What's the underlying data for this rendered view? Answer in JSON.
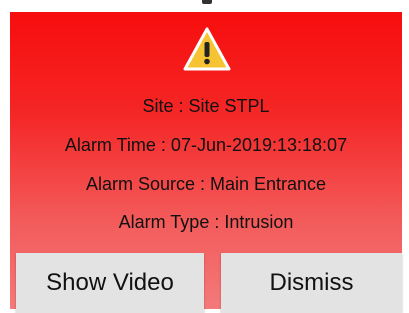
{
  "alarm": {
    "icon": "warning-icon",
    "site_line": "Site : Site STPL",
    "time_line": "Alarm Time : 07-Jun-2019:13:18:07",
    "source_line": "Alarm Source : Main Entrance",
    "type_line": "Alarm Type : Intrusion"
  },
  "actions": {
    "show_video_label": "Show Video",
    "dismiss_label": "Dismiss"
  },
  "colors": {
    "alarm_background_top": "#f70d0d",
    "alarm_background_bottom": "#f37a7a",
    "warning_yellow": "#f6c432",
    "button_background": "#e3e3e3"
  }
}
